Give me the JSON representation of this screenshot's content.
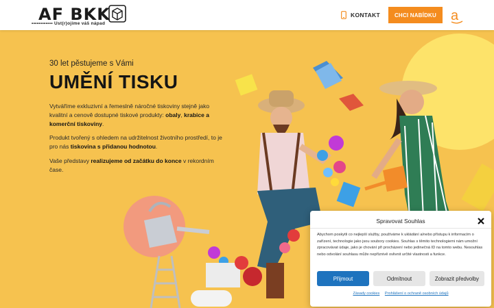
{
  "header": {
    "logo_text": "AF BKK",
    "logo_tagline": "•••••••••••• Ust(r)ojíme váš nápad",
    "contact_label": "KONTAKT",
    "cta_label": "CHCI NABÍDKU",
    "amazon_letter": "a"
  },
  "hero": {
    "subtitle": "30 let pěstujeme s Vámi",
    "title": "UMĚNÍ TISKU",
    "p1": {
      "t1": "Vytváříme exkluzivní a řemeslně náročné tiskoviny stejně jako kvalitní a cenově dostupné tiskové produkty: ",
      "b1": "obaly",
      "t2": ", ",
      "b2": "krabice a komerční tiskoviny",
      "t3": "."
    },
    "p2": {
      "t1": "Produkt tvořený s ohledem na udržitelnost životního prostředí, to je pro nás ",
      "b1": "tiskovina s přidanou hodnotou",
      "t2": "."
    },
    "p3": {
      "t1": "Vaše představy ",
      "b1": "realizujeme od začátku do konce",
      "t2": " v rekordním čase."
    }
  },
  "cookie": {
    "title": "Spravovat Souhlas",
    "body": "Abychom poskytli co nejlepší služby, používáme k ukládání a/nebo přístupu k informacím o zařízení, technologie jako jsou soubory cookies. Souhlas s těmito technologiemi nám umožní zpracovávat údaje, jako je chování při procházení nebo jedinečná ID na tomto webu. Nesouhlas nebo odvolání souhlasu může nepříznivě ovlivnit určité vlastnosti a funkce.",
    "accept_label": "Přijmout",
    "deny_label": "Odmítnout",
    "prefs_label": "Zobrazit předvolby",
    "link_cookies": "Zásady cookies",
    "link_privacy": "Prohlášení o ochraně osobních údajů"
  },
  "colors": {
    "background": "#f6c24f",
    "accent_orange": "#f48c1e",
    "button_blue": "#1e73be"
  }
}
